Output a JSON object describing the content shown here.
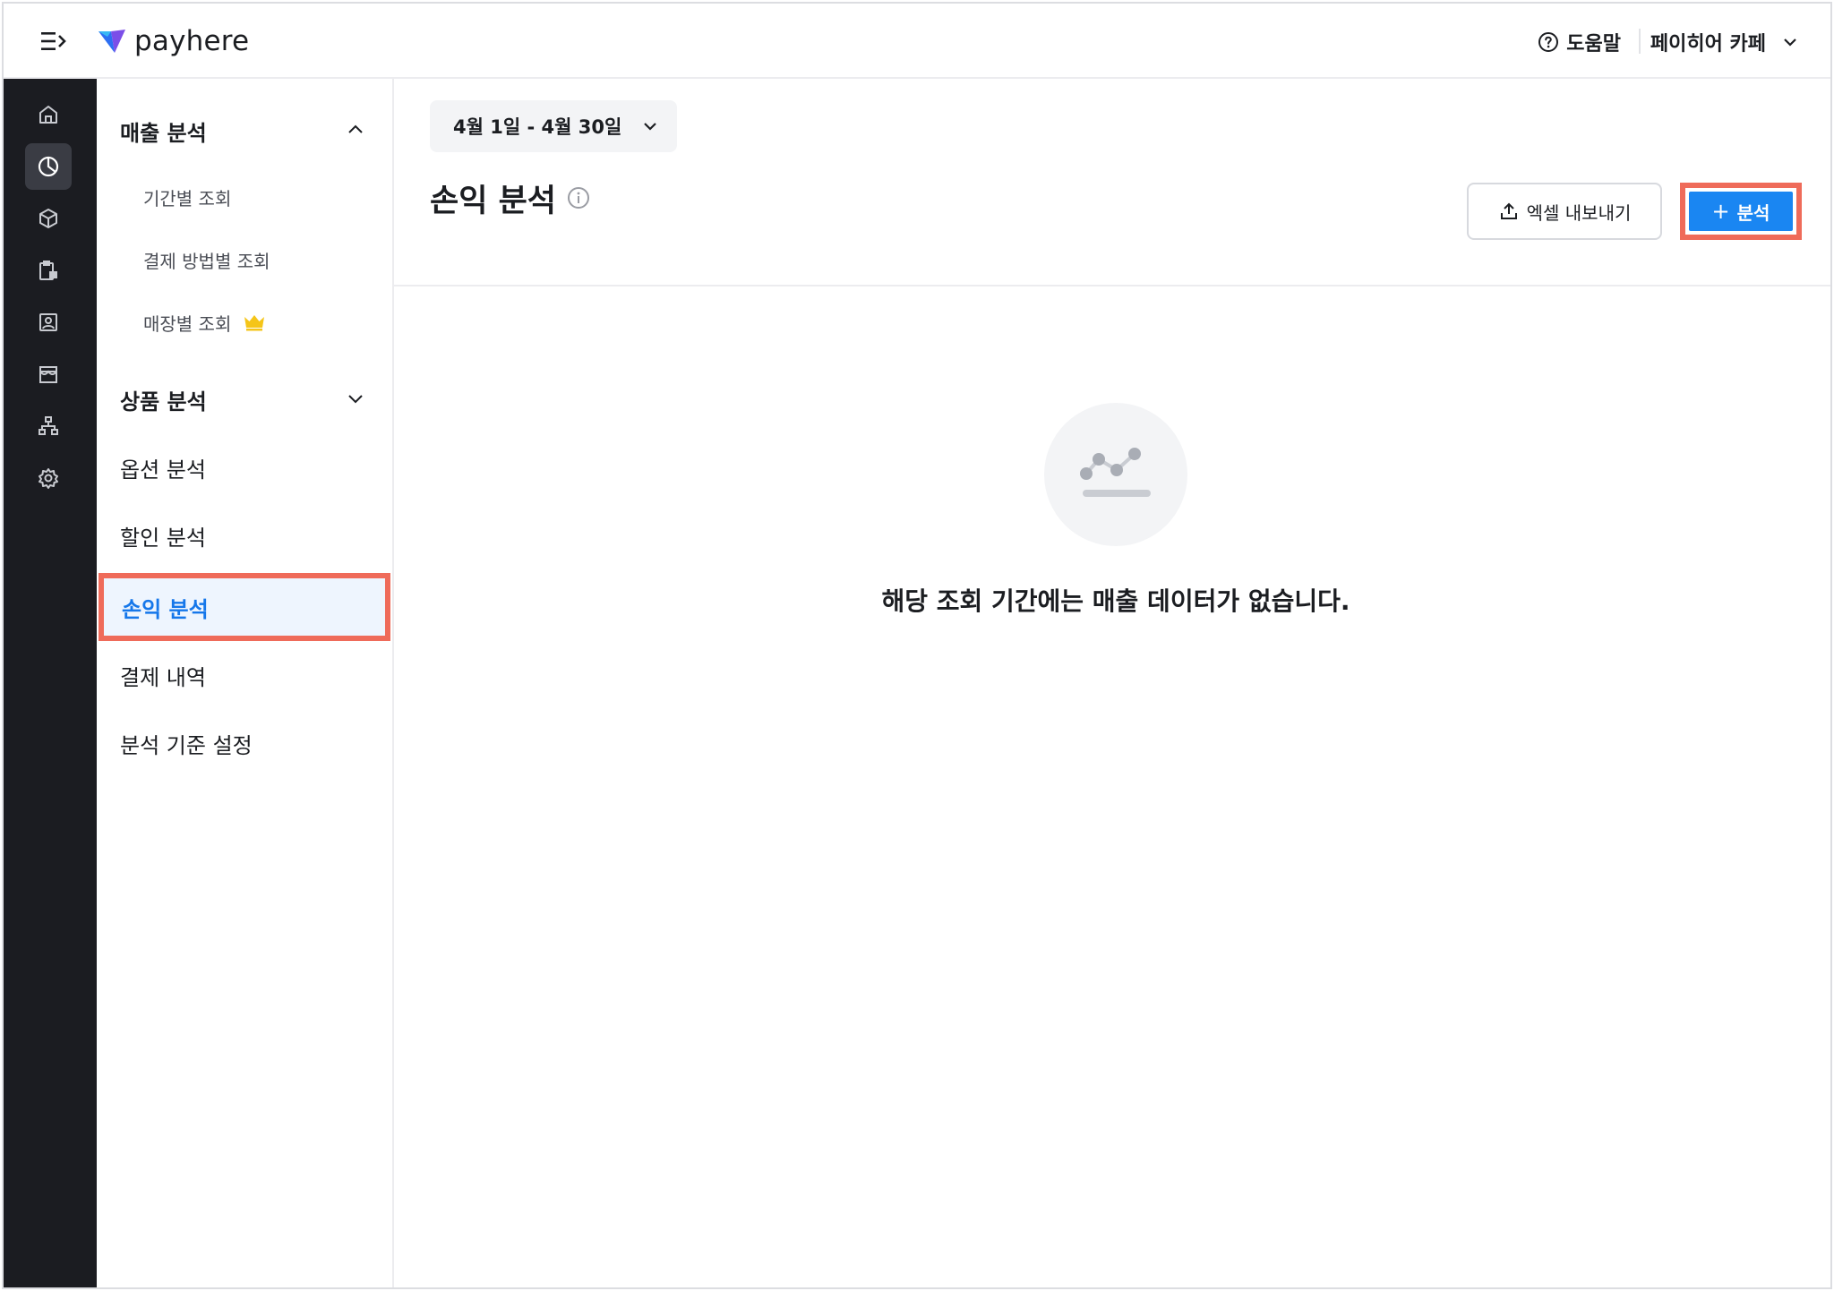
{
  "brand": {
    "name": "payhere",
    "accent_color": "#1a86f2",
    "highlight_color": "#ef6b5a"
  },
  "topbar": {
    "help_label": "도움말",
    "store_name": "페이히어 카페"
  },
  "rail": {
    "items": [
      {
        "icon": "home-icon"
      },
      {
        "icon": "chart-pie-icon",
        "active": true
      },
      {
        "icon": "box-icon"
      },
      {
        "icon": "clipboard-icon"
      },
      {
        "icon": "contact-card-icon"
      },
      {
        "icon": "store-icon"
      },
      {
        "icon": "org-chart-icon"
      },
      {
        "icon": "gear-icon"
      }
    ]
  },
  "submenu": {
    "sales_analysis": {
      "label": "매출 분석",
      "expanded": true,
      "children": [
        {
          "label": "기간별 조회"
        },
        {
          "label": "결제 방법별 조회"
        },
        {
          "label": "매장별 조회",
          "badge_icon": "crown-icon"
        }
      ]
    },
    "product_analysis": {
      "label": "상품 분석",
      "expanded": false
    },
    "option_analysis": {
      "label": "옵션 분석"
    },
    "discount_analysis": {
      "label": "할인 분석"
    },
    "profit_analysis": {
      "label": "손익 분석",
      "active": true
    },
    "payment_history": {
      "label": "결제 내역"
    },
    "analysis_settings": {
      "label": "분석 기준 설정"
    }
  },
  "main": {
    "date_range": "4월 1일 - 4월 30일",
    "title": "손익 분석",
    "export_label": "엑셀 내보내기",
    "add_label": "분석",
    "empty_message": "해당 조회 기간에는 매출 데이터가 없습니다."
  }
}
